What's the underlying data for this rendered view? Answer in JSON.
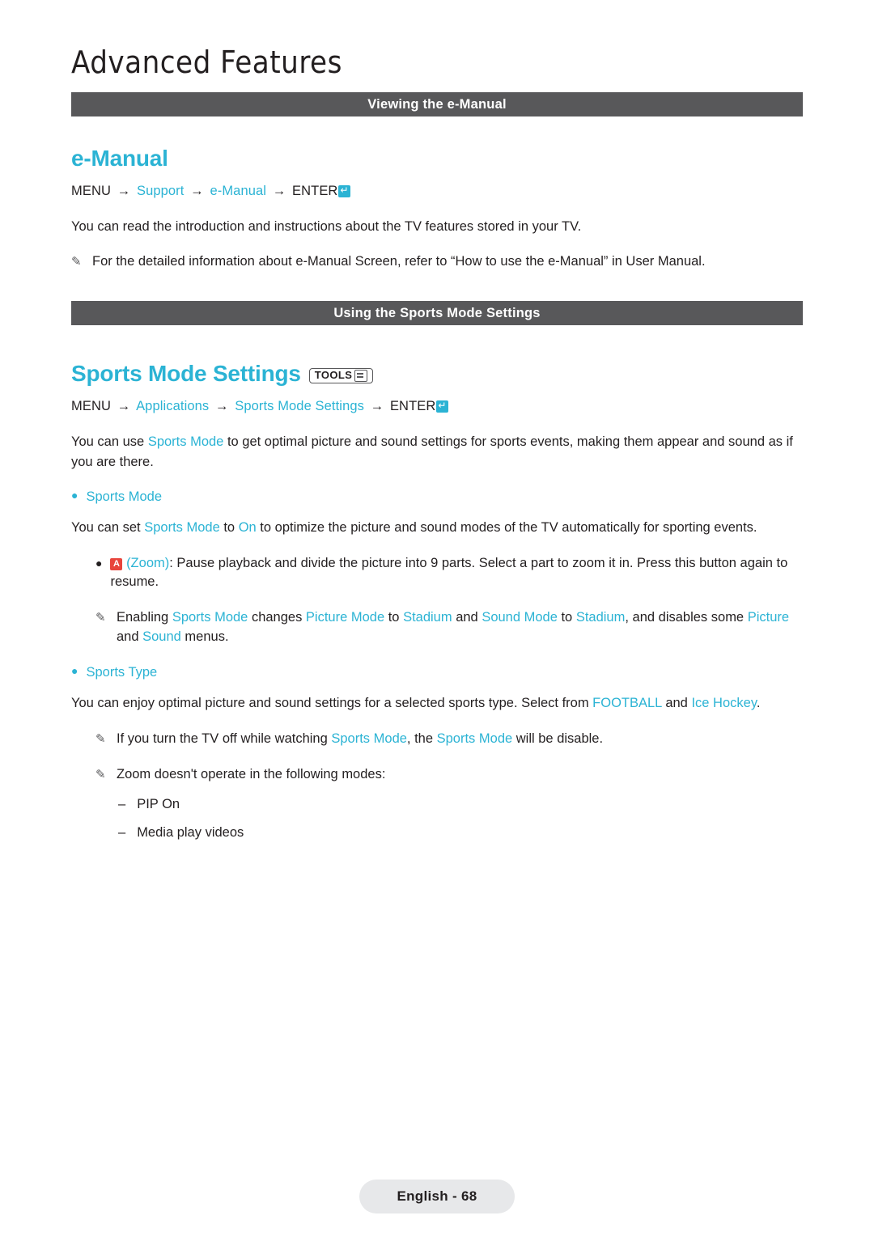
{
  "chapter": {
    "title": "Advanced Features"
  },
  "sections": [
    {
      "bar_label": "Viewing the e-Manual",
      "heading": "e-Manual",
      "menu_path": {
        "menu": "MENU",
        "arrow": "→",
        "items": [
          "Support",
          "e-Manual"
        ],
        "enter": "ENTER"
      },
      "paragraph": "You can read the introduction and instructions about the TV features stored in your TV.",
      "note": "For the detailed information about e-Manual Screen, refer to “How to use the e-Manual” in User Manual."
    },
    {
      "bar_label": "Using the Sports Mode Settings",
      "heading": "Sports Mode Settings",
      "tools_badge": "TOOLS",
      "menu_path": {
        "menu": "MENU",
        "arrow": "→",
        "items": [
          "Applications",
          "Sports Mode Settings"
        ],
        "enter": "ENTER"
      },
      "intro_p1": "You can use ",
      "intro_hl": "Sports Mode",
      "intro_p2": " to get optimal picture and sound settings for sports events, making them appear and sound as if you are there.",
      "bullets": [
        {
          "label": "Sports Mode",
          "body_parts": [
            {
              "t": "You can set ",
              "hl": false
            },
            {
              "t": "Sports Mode",
              "hl": true
            },
            {
              "t": " to ",
              "hl": false
            },
            {
              "t": "On",
              "hl": true
            },
            {
              "t": " to optimize the picture and sound modes of the TV automatically for sporting events.",
              "hl": false
            }
          ],
          "sub_bullet": {
            "badge": "A",
            "zoom_label": "(Zoom)",
            "text": ": Pause playback and divide the picture into 9 parts. Select a part to zoom it in. Press this button again to resume."
          },
          "note_parts": [
            {
              "t": "Enabling ",
              "hl": false
            },
            {
              "t": "Sports Mode",
              "hl": true
            },
            {
              "t": " changes ",
              "hl": false
            },
            {
              "t": "Picture Mode",
              "hl": true
            },
            {
              "t": " to ",
              "hl": false
            },
            {
              "t": "Stadium",
              "hl": true
            },
            {
              "t": " and ",
              "hl": false
            },
            {
              "t": "Sound Mode",
              "hl": true
            },
            {
              "t": " to ",
              "hl": false
            },
            {
              "t": "Stadium",
              "hl": true
            },
            {
              "t": ", and disables some ",
              "hl": false
            },
            {
              "t": "Picture",
              "hl": true
            },
            {
              "t": " and ",
              "hl": false
            },
            {
              "t": "Sound",
              "hl": true
            },
            {
              "t": " menus.",
              "hl": false
            }
          ]
        },
        {
          "label": "Sports Type",
          "body_parts": [
            {
              "t": "You can enjoy optimal picture and sound settings for a selected sports type. Select from ",
              "hl": false
            },
            {
              "t": "FOOTBALL",
              "hl": true
            },
            {
              "t": " and ",
              "hl": false
            },
            {
              "t": "Ice Hockey",
              "hl": true
            },
            {
              "t": ".",
              "hl": false
            }
          ]
        }
      ],
      "notes": [
        [
          {
            "t": "If you turn the TV off while watching ",
            "hl": false
          },
          {
            "t": "Sports Mode",
            "hl": true
          },
          {
            "t": ", the ",
            "hl": false
          },
          {
            "t": "Sports Mode",
            "hl": true
          },
          {
            "t": " will be disable.",
            "hl": false
          }
        ],
        [
          {
            "t": "Zoom doesn't operate in the following modes:",
            "hl": false
          }
        ]
      ],
      "dash_items": [
        "PIP On",
        "Media play videos"
      ]
    }
  ],
  "footer": {
    "page_label": "English - 68"
  },
  "colors": {
    "accent": "#2bb3d4",
    "bar": "#58585a",
    "text": "#231f20",
    "badge_red": "#e8453c",
    "footer_bg": "#e7e8ea"
  }
}
